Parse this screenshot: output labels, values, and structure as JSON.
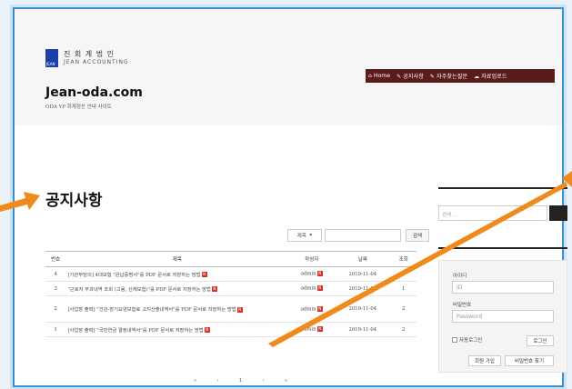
{
  "brand": {
    "logo_small": "JEAN",
    "name_ko": "진 회 계 법 인",
    "name_en": "JEAN ACCOUNTING"
  },
  "site": {
    "title": "Jean-oda.com",
    "subtitle": "ODA YP 회계정산 안내 사이트"
  },
  "nav": {
    "items": [
      {
        "label": "Home",
        "icon": "home-icon"
      },
      {
        "label": "공지사항",
        "icon": "pin-icon"
      },
      {
        "label": "자주찾는질문",
        "icon": "pin-icon"
      },
      {
        "label": "자료업로드",
        "icon": "cloud-icon"
      }
    ]
  },
  "page": {
    "title": "공지사항"
  },
  "board_search": {
    "select_value": "제목",
    "button": "검색"
  },
  "table": {
    "headers": [
      "번호",
      "제목",
      "작성자",
      "날짜",
      "조회"
    ],
    "rows": [
      {
        "no": "4",
        "title": "[기관부담의] 4대보험 \"완납증명서\"를 PDF 문서로 저장하는 방법",
        "author": "admin",
        "date": "2019-11-04",
        "views": "3"
      },
      {
        "no": "3",
        "title": "\"근로자 부과내역 조회 (고용, 산재보험)\"를 PDF 문서로 저장하는 방법",
        "author": "admin",
        "date": "2019-11-04",
        "views": "1"
      },
      {
        "no": "2",
        "title": "[사업장 출력] \"건강-장기요양보험료 고지산출내역서\"를 PDF 문서로 저장하는 방법",
        "author": "admin",
        "date": "2019-11-04",
        "views": "2"
      },
      {
        "no": "1",
        "title": "[사업장 출력] \"국민연금 결정내역서\"를 PDF 문서로 저장하는 방법",
        "author": "admin",
        "date": "2019-11-04",
        "views": "2"
      }
    ],
    "new_badge": "N"
  },
  "pager": [
    "«",
    "‹",
    "1",
    "›",
    "»"
  ],
  "sidebar": {
    "search_placeholder": "검색 ...",
    "login": {
      "id_label": "아이디",
      "id_placeholder": "ID",
      "pw_label": "비밀번호",
      "pw_placeholder": "Password",
      "auto_login": "자동로그인",
      "login_button": "로그인",
      "signup_button": "회원 가입",
      "find_pw_button": "비밀번호 찾기"
    }
  },
  "colors": {
    "nav_bg": "#5a1b1b",
    "logo_blue": "#1f3fa8",
    "arrow": "#f08a1c",
    "new_badge": "#d9342b",
    "frame": "#3a8fd1"
  }
}
